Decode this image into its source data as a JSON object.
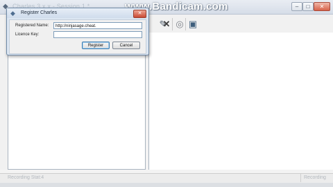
{
  "window": {
    "title": "Charles 3.x.x - Session 1 *",
    "min_glyph": "–",
    "max_glyph": "□",
    "close_glyph": "✕"
  },
  "watermark": {
    "text": "www.Bandicam.com"
  },
  "toolbar": {
    "icons": [
      "pencil-icon",
      "tools-icon",
      "target-icon",
      "registry-icon"
    ],
    "glyphs": {
      "edit": "✎",
      "tools": "✕",
      "target": "◎",
      "registry": "▣"
    }
  },
  "status": {
    "left": "Recording Stat:4",
    "right": "Recording"
  },
  "dialog": {
    "title": "Register Charles",
    "close_glyph": "✕",
    "fields": {
      "name_label": "Registered Name:",
      "name_value": "http://ninjasage.cheat.",
      "key_label": "Licence Key:",
      "key_value": ""
    },
    "buttons": {
      "register": "Register",
      "cancel": "Cancel"
    }
  },
  "colors": {
    "accent": "#6f8aa8",
    "close_red": "#d7624a",
    "window_bg": "#f3f3f3"
  }
}
